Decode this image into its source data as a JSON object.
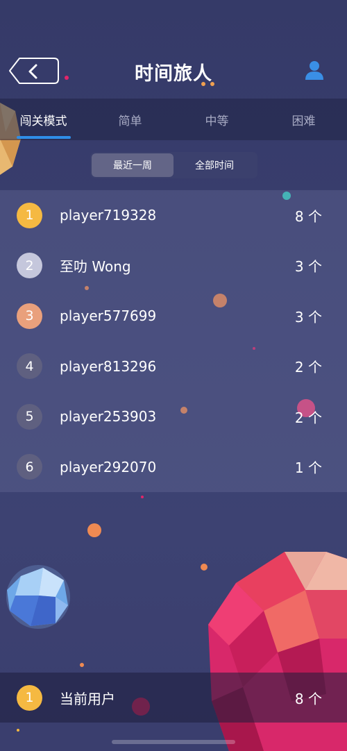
{
  "header": {
    "title": "时间旅人"
  },
  "tabs": [
    {
      "label": "闯关模式"
    },
    {
      "label": "简单"
    },
    {
      "label": "中等"
    },
    {
      "label": "困难"
    }
  ],
  "time_filter": {
    "options": [
      {
        "label": "最近一周"
      },
      {
        "label": "全部时间"
      }
    ]
  },
  "leaderboard": [
    {
      "rank": "1",
      "name": "player719328",
      "count": "8 个",
      "badge_color": "#f5b942"
    },
    {
      "rank": "2",
      "name": "至叻 Wong",
      "count": "3 个",
      "badge_color": "#c5c7dc"
    },
    {
      "rank": "3",
      "name": "player577699",
      "count": "3 个",
      "badge_color": "#e9a07c"
    },
    {
      "rank": "4",
      "name": "player813296",
      "count": "2 个",
      "badge_color": "#5f6080"
    },
    {
      "rank": "5",
      "name": "player253903",
      "count": "2 个",
      "badge_color": "#5f6080"
    },
    {
      "rank": "6",
      "name": "player292070",
      "count": "1 个",
      "badge_color": "#5f6080"
    }
  ],
  "current_user": {
    "rank": "1",
    "name": "当前用户",
    "count": "8 个",
    "badge_color": "#f5b942"
  },
  "colors": {
    "accent": "#2f8ee8",
    "user_icon": "#3a8fe6"
  }
}
